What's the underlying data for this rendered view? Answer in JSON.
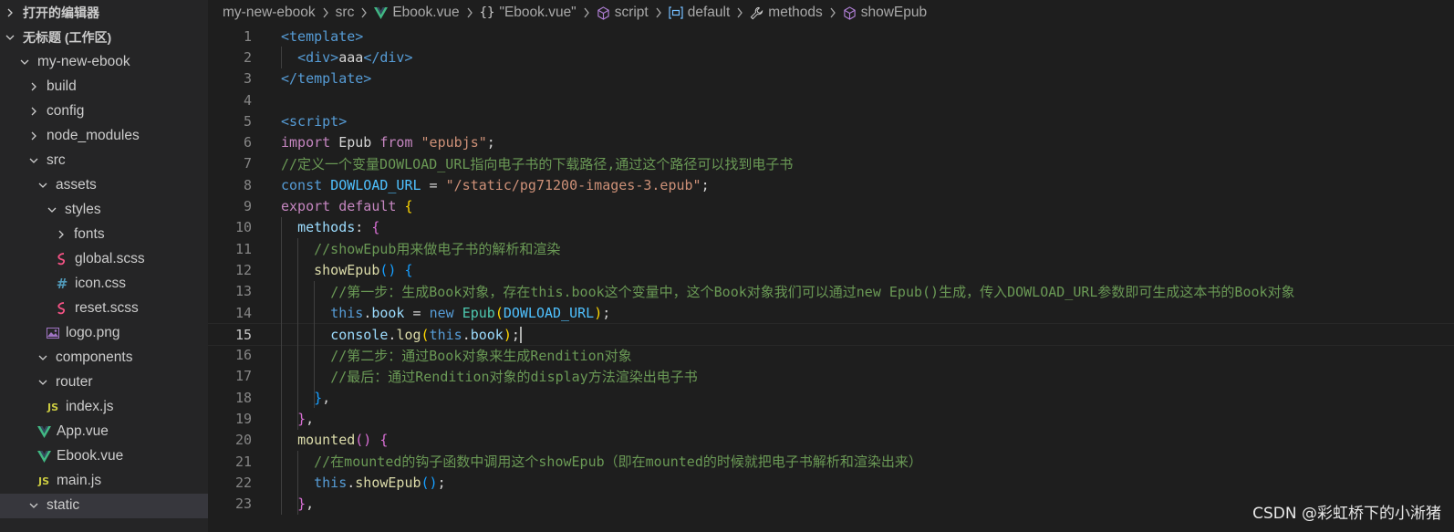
{
  "sidebar": {
    "open_editors_label": "打开的编辑器",
    "workspace_label": "无标题 (工作区)",
    "tree": [
      {
        "label": "my-new-ebook",
        "type": "folder",
        "expanded": true,
        "depth": 1
      },
      {
        "label": "build",
        "type": "folder",
        "expanded": false,
        "depth": 2
      },
      {
        "label": "config",
        "type": "folder",
        "expanded": false,
        "depth": 2
      },
      {
        "label": "node_modules",
        "type": "folder",
        "expanded": false,
        "depth": 2
      },
      {
        "label": "src",
        "type": "folder",
        "expanded": true,
        "depth": 2
      },
      {
        "label": "assets",
        "type": "folder",
        "expanded": true,
        "depth": 3
      },
      {
        "label": "styles",
        "type": "folder",
        "expanded": true,
        "depth": 4
      },
      {
        "label": "fonts",
        "type": "folder",
        "expanded": false,
        "depth": 5
      },
      {
        "label": "global.scss",
        "type": "scss",
        "depth": 5
      },
      {
        "label": "icon.css",
        "type": "css",
        "depth": 5
      },
      {
        "label": "reset.scss",
        "type": "scss",
        "depth": 5
      },
      {
        "label": "logo.png",
        "type": "image",
        "depth": 4
      },
      {
        "label": "components",
        "type": "folder",
        "expanded": true,
        "depth": 3
      },
      {
        "label": "router",
        "type": "folder",
        "expanded": true,
        "depth": 3
      },
      {
        "label": "index.js",
        "type": "js",
        "depth": 4
      },
      {
        "label": "App.vue",
        "type": "vue",
        "depth": 3
      },
      {
        "label": "Ebook.vue",
        "type": "vue",
        "depth": 3
      },
      {
        "label": "main.js",
        "type": "js",
        "depth": 3
      },
      {
        "label": "static",
        "type": "folder",
        "expanded": true,
        "depth": 2,
        "selected": true
      }
    ]
  },
  "breadcrumb": {
    "items": [
      {
        "label": "my-new-ebook",
        "icon": ""
      },
      {
        "label": "src",
        "icon": ""
      },
      {
        "label": "Ebook.vue",
        "icon": "vue-icon"
      },
      {
        "label": "\"Ebook.vue\"",
        "icon": "braces-icon"
      },
      {
        "label": "script",
        "icon": "cube-icon"
      },
      {
        "label": "default",
        "icon": "variable-icon"
      },
      {
        "label": "methods",
        "icon": "wrench-icon"
      },
      {
        "label": "showEpub",
        "icon": "cube-icon"
      }
    ]
  },
  "editor": {
    "current_line": 15,
    "lines": [
      {
        "n": "1",
        "t": [
          [
            "tag",
            "<template>"
          ]
        ]
      },
      {
        "n": "2",
        "t": [
          [
            "plain",
            "  "
          ],
          [
            "tag",
            "<div>"
          ],
          [
            "plain",
            "aaa"
          ],
          [
            "tag",
            "</div>"
          ]
        ]
      },
      {
        "n": "3",
        "t": [
          [
            "tag",
            "</template>"
          ]
        ]
      },
      {
        "n": "4",
        "t": []
      },
      {
        "n": "5",
        "t": [
          [
            "tag",
            "<script>"
          ]
        ]
      },
      {
        "n": "6",
        "t": [
          [
            "kw",
            "import"
          ],
          [
            "plain",
            " Epub "
          ],
          [
            "kw",
            "from"
          ],
          [
            "plain",
            " "
          ],
          [
            "str",
            "\"epubjs\""
          ],
          [
            "plain",
            ";"
          ]
        ]
      },
      {
        "n": "7",
        "t": [
          [
            "cmt",
            "//定义一个变量DOWLOAD_URL指向电子书的下载路径,通过这个路径可以找到电子书"
          ]
        ]
      },
      {
        "n": "8",
        "t": [
          [
            "kwb",
            "const"
          ],
          [
            "plain",
            " "
          ],
          [
            "var",
            "DOWLOAD_URL"
          ],
          [
            "plain",
            " = "
          ],
          [
            "str",
            "\"/static/pg71200-images-3.epub\""
          ],
          [
            "plain",
            ";"
          ]
        ]
      },
      {
        "n": "9",
        "t": [
          [
            "kw",
            "export"
          ],
          [
            "plain",
            " "
          ],
          [
            "kw",
            "default"
          ],
          [
            "plain",
            " "
          ],
          [
            "br1",
            "{"
          ]
        ]
      },
      {
        "n": "10",
        "t": [
          [
            "plain",
            "  "
          ],
          [
            "var2",
            "methods"
          ],
          [
            "plain",
            ": "
          ],
          [
            "br2",
            "{"
          ]
        ]
      },
      {
        "n": "11",
        "t": [
          [
            "plain",
            "    "
          ],
          [
            "cmt",
            "//showEpub用来做电子书的解析和渲染"
          ]
        ]
      },
      {
        "n": "12",
        "t": [
          [
            "plain",
            "    "
          ],
          [
            "fn",
            "showEpub"
          ],
          [
            "br3",
            "()"
          ],
          [
            "plain",
            " "
          ],
          [
            "br3",
            "{"
          ]
        ]
      },
      {
        "n": "13",
        "t": [
          [
            "plain",
            "      "
          ],
          [
            "cmt",
            "//第一步：生成Book对象，存在this.book这个变量中，这个Book对象我们可以通过new Epub()生成，传入DOWLOAD_URL参数即可生成这本书的Book对象"
          ]
        ]
      },
      {
        "n": "14",
        "t": [
          [
            "plain",
            "      "
          ],
          [
            "kwb",
            "this"
          ],
          [
            "plain",
            "."
          ],
          [
            "var2",
            "book"
          ],
          [
            "plain",
            " = "
          ],
          [
            "kwb",
            "new"
          ],
          [
            "plain",
            " "
          ],
          [
            "cls",
            "Epub"
          ],
          [
            "br1",
            "("
          ],
          [
            "var",
            "DOWLOAD_URL"
          ],
          [
            "br1",
            ")"
          ],
          [
            "plain",
            ";"
          ]
        ]
      },
      {
        "n": "15",
        "t": [
          [
            "plain",
            "      "
          ],
          [
            "var2",
            "console"
          ],
          [
            "plain",
            "."
          ],
          [
            "fn",
            "log"
          ],
          [
            "br1",
            "("
          ],
          [
            "kwb",
            "this"
          ],
          [
            "plain",
            "."
          ],
          [
            "var2",
            "book"
          ],
          [
            "br1",
            ")"
          ],
          [
            "plain",
            ";"
          ]
        ],
        "cursor": true
      },
      {
        "n": "16",
        "t": [
          [
            "plain",
            "      "
          ],
          [
            "cmt",
            "//第二步：通过Book对象来生成Rendition对象"
          ]
        ]
      },
      {
        "n": "17",
        "t": [
          [
            "plain",
            "      "
          ],
          [
            "cmt",
            "//最后：通过Rendition对象的display方法渲染出电子书"
          ]
        ]
      },
      {
        "n": "18",
        "t": [
          [
            "plain",
            "    "
          ],
          [
            "br3",
            "}"
          ],
          [
            "plain",
            ","
          ]
        ]
      },
      {
        "n": "19",
        "t": [
          [
            "plain",
            "  "
          ],
          [
            "br2",
            "}"
          ],
          [
            "plain",
            ","
          ]
        ]
      },
      {
        "n": "20",
        "t": [
          [
            "plain",
            "  "
          ],
          [
            "fn",
            "mounted"
          ],
          [
            "br2",
            "()"
          ],
          [
            "plain",
            " "
          ],
          [
            "br2",
            "{"
          ]
        ]
      },
      {
        "n": "21",
        "t": [
          [
            "plain",
            "    "
          ],
          [
            "cmt",
            "//在mounted的钩子函数中调用这个showEpub（即在mounted的时候就把电子书解析和渲染出来）"
          ]
        ]
      },
      {
        "n": "22",
        "t": [
          [
            "plain",
            "    "
          ],
          [
            "kwb",
            "this"
          ],
          [
            "plain",
            "."
          ],
          [
            "fn",
            "showEpub"
          ],
          [
            "br3",
            "()"
          ],
          [
            "plain",
            ";"
          ]
        ]
      },
      {
        "n": "23",
        "t": [
          [
            "plain",
            "  "
          ],
          [
            "br2",
            "}"
          ],
          [
            "plain",
            ","
          ]
        ]
      }
    ]
  },
  "watermark": "CSDN @彩虹桥下的小淅猪"
}
